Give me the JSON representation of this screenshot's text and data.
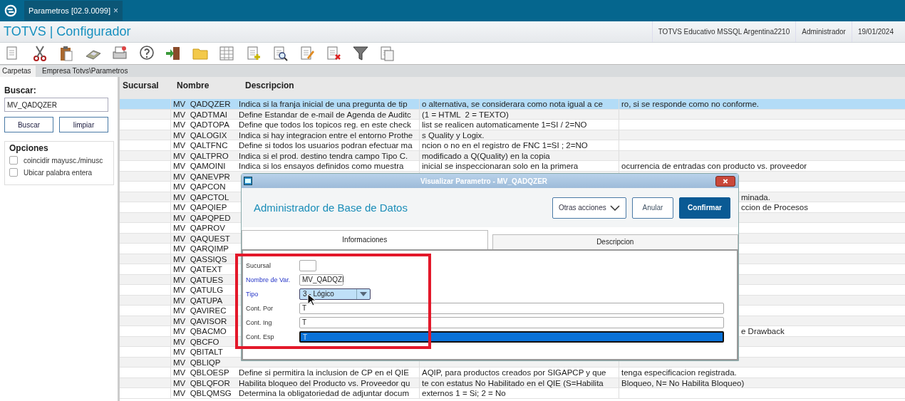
{
  "app_tab": {
    "title": "Parametros [02.9.0099]",
    "close": "×"
  },
  "header": {
    "title": "TOTVS | Configurador",
    "info": [
      "TOTVS Educativo MSSQL Argentina2210",
      "Administrador",
      "19/01/2024"
    ]
  },
  "panel_tabs": [
    {
      "label": "Carpetas",
      "selected": true
    },
    {
      "label": "Empresa Totvs\\Parametros",
      "selected": false
    }
  ],
  "search": {
    "label": "Buscar:",
    "value": "MV_QADQZER",
    "buttons": [
      "Buscar",
      "limpiar"
    ]
  },
  "options": {
    "title": "Opciones",
    "items": [
      {
        "label": "coincidir mayusc./minusc",
        "checked": false
      },
      {
        "label": "Ubicar palabra entera",
        "checked": false
      }
    ]
  },
  "table": {
    "columns": [
      "Sucursal",
      "Nombre",
      "Descripcion"
    ],
    "rows": [
      {
        "name": "MV  QADQZER",
        "desc": [
          "Indica si la franja inicial de una pregunta de tip",
          "o alternativa, se considerara como nota igual a ce",
          "ro, si se responde como no conforme."
        ],
        "selected": true
      },
      {
        "name": "MV  QADTMAI",
        "desc": [
          "Define Estandar de e-mail de Agenda de Auditc",
          "(1 = HTML  2 = TEXTO)"
        ],
        "selected": false
      },
      {
        "name": "MV  QADTOPA",
        "desc": [
          "Define que todos los topicos reg. en este check",
          "list se realicen automaticamente 1=SI / 2=NO"
        ],
        "selected": false
      },
      {
        "name": "MV  QALOGIX",
        "desc": [
          "Indica si hay integracion entre el entorno Prothe",
          "s Quality y Logix."
        ],
        "selected": false
      },
      {
        "name": "MV  QALTFNC",
        "desc": [
          "Define si todos los usuarios podran efectuar ma",
          "ncion o no en el registro de FNC 1=SI ; 2=NO"
        ],
        "selected": false
      },
      {
        "name": "MV  QALTPRO",
        "desc": [
          "Indica si el prod. destino tendra campo Tipo C.",
          "modificado a Q(Quality) en la copia"
        ],
        "selected": false
      },
      {
        "name": "MV  QAMOINI",
        "desc": [
          "Indica si los ensayos definidos como muestra",
          "inicial se inspeccionaran solo en la primera",
          "ocurrencia de entradas con producto vs. proveedor"
        ],
        "selected": false
      },
      {
        "name": "MV  QANEVPR",
        "selected": false
      },
      {
        "name": "MV  QAPCON",
        "selected": false
      },
      {
        "name": "MV  QAPCTOL",
        "tail": "minada.",
        "selected": false
      },
      {
        "name": "MV  QAPQIEP",
        "tail": "ccion de Procesos",
        "selected": false
      },
      {
        "name": "MV  QAPQPED",
        "selected": false
      },
      {
        "name": "MV  QAPROV",
        "selected": false
      },
      {
        "name": "MV  QAQUEST",
        "selected": false
      },
      {
        "name": "MV  QARQIMP",
        "selected": false
      },
      {
        "name": "MV  QASSIQS",
        "selected": false
      },
      {
        "name": "MV  QATEXT",
        "selected": false
      },
      {
        "name": "MV  QATUES",
        "selected": false
      },
      {
        "name": "MV  QATULG",
        "selected": false
      },
      {
        "name": "MV  QATUPA",
        "selected": false
      },
      {
        "name": "MV  QAVIREC",
        "selected": false
      },
      {
        "name": "MV  QAVISOR",
        "selected": false
      },
      {
        "name": "MV  QBACMO",
        "tail": "e Drawback",
        "selected": false
      },
      {
        "name": "MV  QBCFO",
        "selected": false
      },
      {
        "name": "MV  QBITALT",
        "selected": false
      },
      {
        "name": "MV  QBLIQP",
        "selected": false
      },
      {
        "name": "MV  QBLOESP",
        "desc": [
          "Define si permitira la inclusion de CP en el QIE",
          "AQIP, para productos creados por SIGAPCP y que",
          "tenga especificacion registrada."
        ],
        "selected": false
      },
      {
        "name": "MV  QBLQFOR",
        "desc": [
          "Habilita bloqueo del Producto vs. Proveedor qu",
          "te con estatus No Habilitado en el QIE (S=Habilita",
          "Bloqueo, N= No Habilita Bloqueo)"
        ],
        "selected": false
      },
      {
        "name": "MV  QBLQMSG",
        "desc": [
          "Determina la obligatoriedad de adjuntar docum",
          "externos 1 = Si; 2 = No"
        ],
        "selected": false
      }
    ]
  },
  "dialog": {
    "title": "Visualizar Parametro - MV_QADQZER",
    "heading": "Administrador de Base de Datos",
    "buttons": [
      {
        "label": "Otras acciones",
        "kind": "menu"
      },
      {
        "label": "Anular",
        "kind": "secondary"
      },
      {
        "label": "Confirmar",
        "kind": "primary"
      }
    ],
    "tabs": [
      {
        "label": "Informaciones",
        "selected": true
      },
      {
        "label": "Descripcion",
        "selected": false
      }
    ],
    "fields": [
      {
        "label": "Sucursal",
        "required": false,
        "kind": "short"
      },
      {
        "label": "Nombre de Var.",
        "required": true,
        "kind": "name",
        "value": "MV_QADQZI"
      },
      {
        "label": "Tipo",
        "required": true,
        "kind": "select",
        "value": "3 - Lógico"
      },
      {
        "label": "Cont. Por",
        "required": false,
        "kind": "text",
        "value": "T",
        "focused": false
      },
      {
        "label": "Cont. Ing",
        "required": false,
        "kind": "text",
        "value": "T",
        "focused": false
      },
      {
        "label": "Cont. Esp",
        "required": false,
        "kind": "text",
        "value": "T",
        "focused": true
      }
    ]
  }
}
